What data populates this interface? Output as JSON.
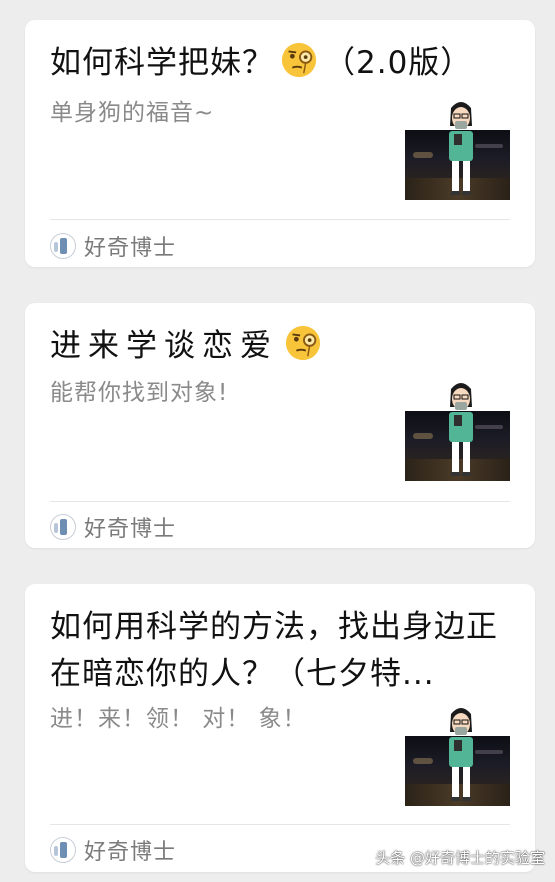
{
  "articles": [
    {
      "title_pre": "如何科学把妹？",
      "title_post": "（2.0版）",
      "emoji": "monocle-face",
      "subtitle": "单身狗的福音~",
      "account": "好奇博士"
    },
    {
      "title_pre": "进来学谈恋爱",
      "title_post": "",
      "emoji": "monocle-face",
      "subtitle": "能帮你找到对象!",
      "account": "好奇博士"
    },
    {
      "title_pre": "如何用科学的方法，找出身边正在暗恋你的人？（七夕特...",
      "title_post": "",
      "emoji": "",
      "subtitle": "进！来！领！ 对！ 象！",
      "account": "好奇博士"
    }
  ],
  "watermark": "头条 @好奇博士的实验室"
}
